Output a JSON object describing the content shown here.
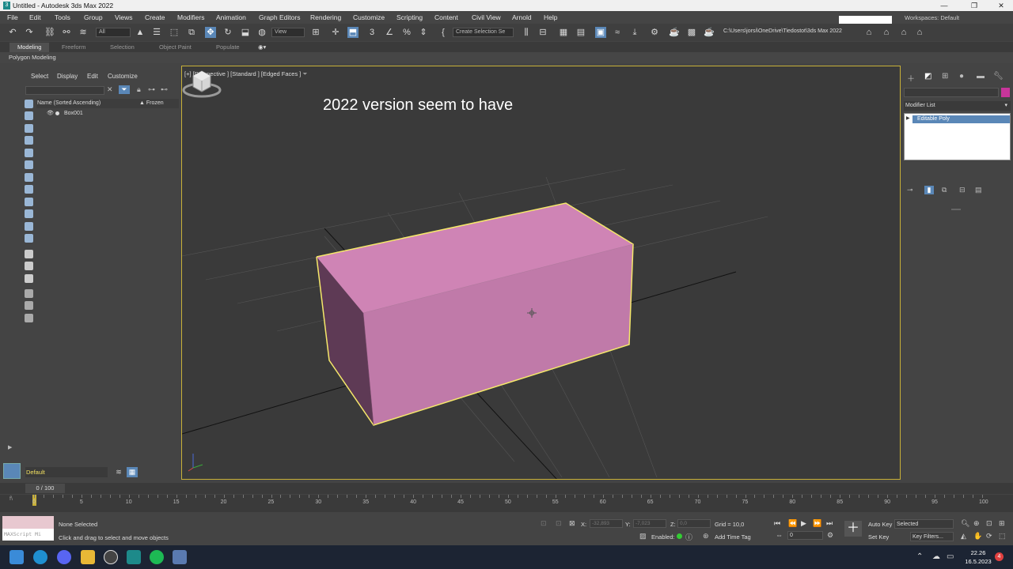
{
  "window": {
    "title": "Untitled - Autodesk 3ds Max 2022",
    "app_icon": "3"
  },
  "menu": [
    "File",
    "Edit",
    "Tools",
    "Group",
    "Views",
    "Create",
    "Modifiers",
    "Animation",
    "Graph Editors",
    "Rendering",
    "Customize",
    "Scripting",
    "Content",
    "Civil View",
    "Arnold",
    "Help"
  ],
  "workspace": {
    "label": "Workspaces:",
    "value": "Default"
  },
  "toolbar": {
    "filter_value": "All",
    "view_value": "View",
    "selection_set_value": "Create Selection Se",
    "project_path": "C:\\Users\\jorsi\\OneDrive\\Tiedostot\\3ds Max 2022"
  },
  "ribbon": {
    "tabs": [
      "Modeling",
      "Freeform",
      "Selection",
      "Object Paint",
      "Populate"
    ],
    "active_tab": "Modeling",
    "sub_label": "Polygon Modeling"
  },
  "scene_explorer": {
    "menus": [
      "Select",
      "Display",
      "Edit",
      "Customize"
    ],
    "column_name": "Name (Sorted Ascending)",
    "column_frozen": "▲ Frozen",
    "rows": [
      {
        "name": "Box001"
      }
    ],
    "layer": "Default"
  },
  "viewport": {
    "label": "[+] [Perspective ] [Standard ] [Edged Faces ]",
    "overlay_text": "2022 version seem to have",
    "object_color": "#cf84b5"
  },
  "command_panel": {
    "modifier_list_label": "Modifier List",
    "stack": [
      "Editable Poly"
    ],
    "object_color": "#c8359b"
  },
  "timeline": {
    "slider_label": "0 / 100",
    "ticks": [
      0,
      5,
      10,
      15,
      20,
      25,
      30,
      35,
      40,
      45,
      50,
      55,
      60,
      65,
      70,
      75,
      80,
      85,
      90,
      95,
      100
    ]
  },
  "status": {
    "maxscript_label": "MAXScript Mi",
    "selection": "None Selected",
    "prompt": "Click and drag to select and move objects",
    "x_label": "X:",
    "x_value": "-32,893",
    "y_label": "Y:",
    "y_value": "-7,023",
    "z_label": "Z:",
    "z_value": "0,0",
    "grid": "Grid = 10,0",
    "enabled_label": "Enabled:",
    "add_time_tag": "Add Time Tag",
    "frame_value": "0",
    "auto_key": "Auto Key",
    "set_key": "Set Key",
    "auto_key_target": "Selected",
    "key_filters": "Key Filters..."
  },
  "taskbar": {
    "time": "22.26",
    "date": "16.5.2023",
    "notifications": "4"
  }
}
